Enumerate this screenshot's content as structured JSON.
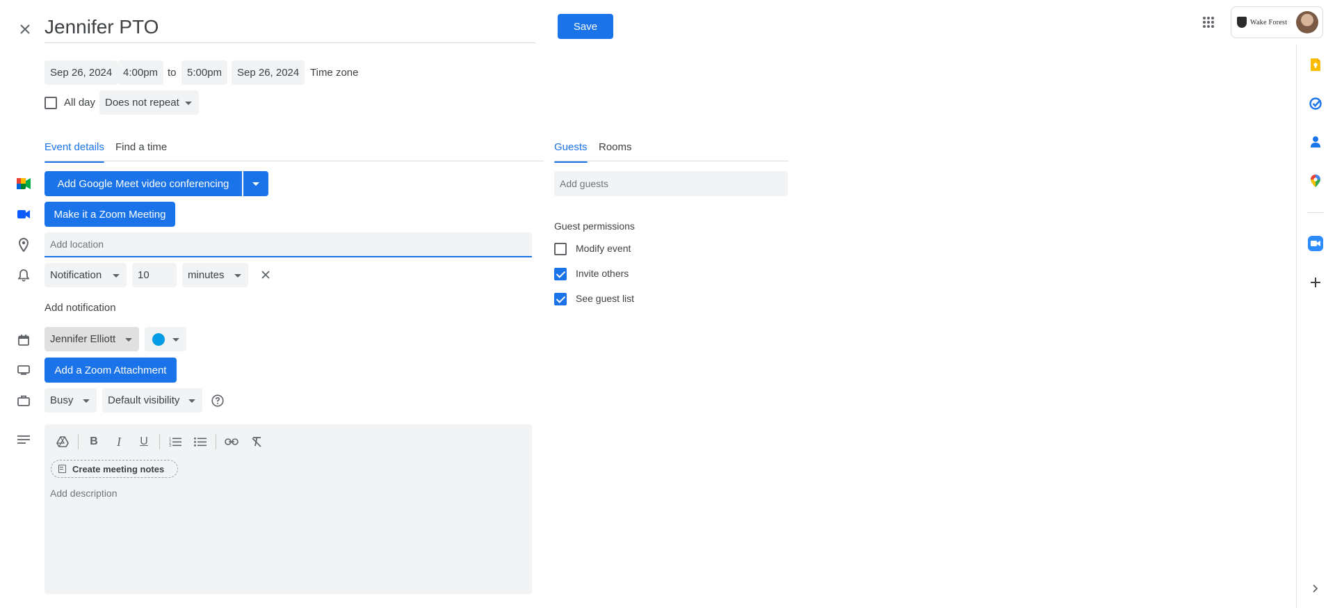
{
  "header": {
    "title": "Jennifer PTO",
    "save_label": "Save",
    "account_label": "Wake Forest"
  },
  "datetime": {
    "start_date": "Sep 26, 2024",
    "start_time": "4:00pm",
    "to_label": "to",
    "end_time": "5:00pm",
    "end_date": "Sep 26, 2024",
    "timezone_label": "Time zone",
    "allday_label": "All day",
    "repeat": "Does not repeat"
  },
  "tabs": {
    "event_details": "Event details",
    "find_time": "Find a time",
    "guests": "Guests",
    "rooms": "Rooms"
  },
  "event": {
    "meet_label": "Add Google Meet video conferencing",
    "zoom_meeting_label": "Make it a Zoom Meeting",
    "location_placeholder": "Add location",
    "notification_type": "Notification",
    "notification_value": "10",
    "notification_unit": "minutes",
    "add_notification": "Add notification",
    "calendar_owner": "Jennifer Elliott",
    "calendar_color": "#039be5",
    "zoom_attachment_label": "Add a Zoom Attachment",
    "availability": "Busy",
    "visibility": "Default visibility",
    "meeting_notes_label": "Create meeting notes",
    "description_placeholder": "Add description"
  },
  "guests": {
    "add_placeholder": "Add guests",
    "permissions_title": "Guest permissions",
    "permissions": [
      {
        "label": "Modify event",
        "checked": false
      },
      {
        "label": "Invite others",
        "checked": true
      },
      {
        "label": "See guest list",
        "checked": true
      }
    ]
  },
  "colors": {
    "accent": "#1a73e8",
    "field_bg": "#f1f3f4"
  }
}
